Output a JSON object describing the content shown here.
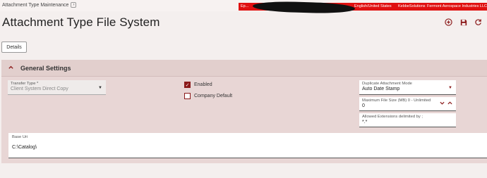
{
  "header": {
    "breadcrumb": "Attachment Type Maintenance",
    "breadcrumb_chevron": "›",
    "status_bar": {
      "left": "Ep...",
      "language": "English/United States",
      "company": "KebbeSolutions",
      "site": "Fermont Aerospace Industries LLC"
    }
  },
  "page": {
    "title": "Attachment Type File System"
  },
  "tabs": {
    "details_label": "Details"
  },
  "section": {
    "title": "General Settings",
    "transfer_type": {
      "label": "Transfer Type *",
      "value": "Client System Direct Copy"
    },
    "enabled": {
      "label": "Enabled",
      "checked": true
    },
    "company_default": {
      "label": "Company Default",
      "checked": false
    },
    "duplicate_mode": {
      "label": "Duplicate Attachment Mode",
      "value": "Auto Date Stamp"
    },
    "max_file_size": {
      "label": "Maximum File Size (MB) 0 - Unlimited",
      "value": "0"
    },
    "allowed_extensions": {
      "label": "Allowed Extensions delimited by ;",
      "value": "*.*"
    },
    "base_uri": {
      "label": "Base Uri",
      "value": "C:\\Catalog\\"
    }
  },
  "colors": {
    "accent": "#8b1a1a",
    "status_bar": "#e01010",
    "panel": "#e8d6d5"
  }
}
